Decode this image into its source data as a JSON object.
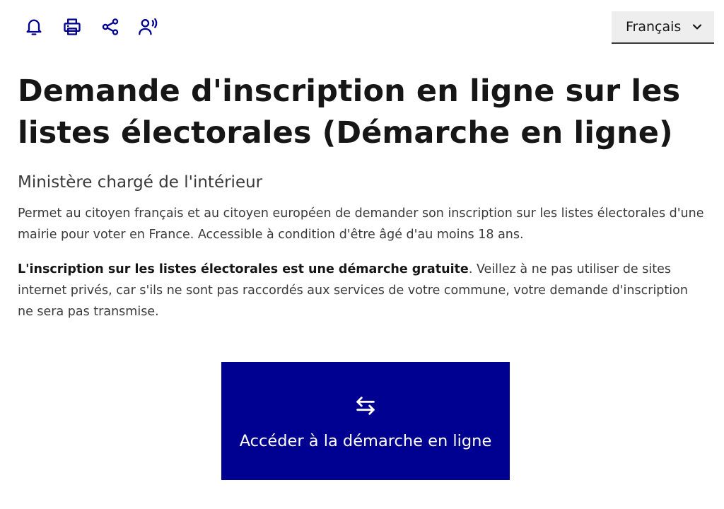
{
  "toolbar": {
    "icons": [
      {
        "name": "bell-icon",
        "label": "Notifications"
      },
      {
        "name": "print-icon",
        "label": "Imprimer"
      },
      {
        "name": "share-icon",
        "label": "Partager"
      },
      {
        "name": "read-aloud-icon",
        "label": "Écouter"
      }
    ],
    "accent_color": "#000091"
  },
  "language_select": {
    "value": "Français",
    "icon": "chevron-down-icon"
  },
  "main": {
    "title": "Demande d'inscription en ligne sur les listes électorales (Démarche en ligne)",
    "ministry": "Ministère chargé de l'intérieur",
    "description": "Permet au citoyen français et au citoyen européen de demander son inscription sur les listes électorales d'une mairie pour voter en France. Accessible à condition d'être âgé d'au moins 18 ans.",
    "notice_bold": "L'inscription sur les listes électorales est une démarche gratuite",
    "notice_rest": ". Veillez à ne pas utiliser de sites internet privés, car s'ils ne sont pas raccordés aux services de votre commune, votre demande d'inscription ne sera pas transmise."
  },
  "cta": {
    "label": "Accéder à la démarche en ligne",
    "icon": "swap-arrows-icon",
    "background": "#000091"
  }
}
